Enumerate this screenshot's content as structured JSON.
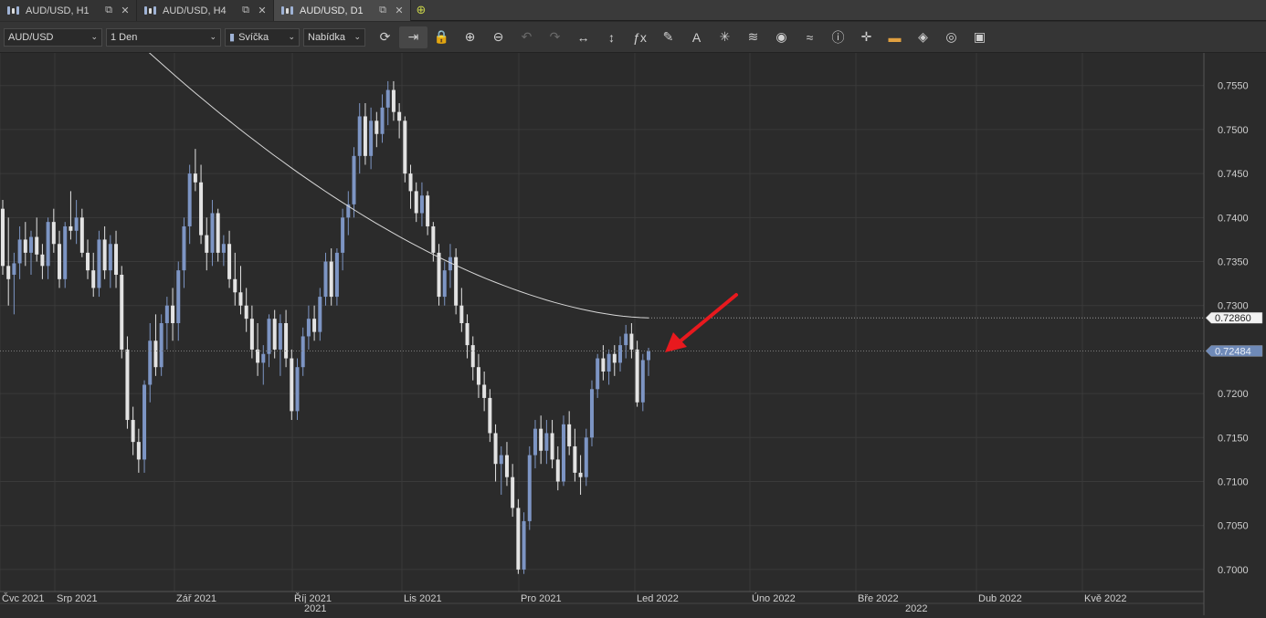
{
  "tabs": [
    {
      "label": "AUD/USD, H1",
      "active": false
    },
    {
      "label": "AUD/USD, H4",
      "active": false
    },
    {
      "label": "AUD/USD, D1",
      "active": true
    }
  ],
  "toolbar": {
    "symbol": "AUD/USD",
    "timeframe": "1 Den",
    "chart_type": "Svíčka",
    "price_type": "Nabídka",
    "icons": [
      "refresh-icon",
      "auto-scroll-icon",
      "lock-icon",
      "zoom-in-icon",
      "zoom-out-icon",
      "undo-icon",
      "redo-icon",
      "horizontal-fit-icon",
      "vertical-fit-icon",
      "indicator-fx-icon",
      "pencil-icon",
      "text-tool-icon",
      "crosshair-star-icon",
      "layers-icon",
      "eye-icon",
      "strategy-icon",
      "info-icon",
      "crosshair-icon",
      "color-bar-icon",
      "paint-bucket-icon",
      "target-icon",
      "save-icon"
    ]
  },
  "chart_data": {
    "type": "candlestick",
    "symbol": "AUD/USD",
    "timeframe": "D1",
    "ylim": [
      0.6975,
      0.7585
    ],
    "y_ticks": [
      "0.7550",
      "0.7500",
      "0.7450",
      "0.7400",
      "0.7350",
      "0.7300",
      "0.7200",
      "0.7150",
      "0.7100",
      "0.7050",
      "0.7000"
    ],
    "x_month_labels": [
      "Čvc 2021",
      "Srp 2021",
      "Zář 2021",
      "Říj 2021",
      "Lis 2021",
      "Pro 2021",
      "Led 2022",
      "Úno 2022",
      "Bře 2022",
      "Dub 2022",
      "Kvě 2022"
    ],
    "x_year_labels": [
      "2021",
      "2022"
    ],
    "ma_label": "0.72860",
    "ma_value": 0.7286,
    "last_price_label": "0.72484",
    "last_price": 0.72484,
    "colors": {
      "bull": "#7d95c4",
      "bear": "#e3e3e3",
      "ma": "#d8d8d8",
      "arrow": "#e8191e",
      "grid": "#3a3a3a",
      "bg": "#2b2b2b"
    },
    "candles": [
      [
        0.741,
        0.742,
        0.7335,
        0.7345
      ],
      [
        0.7345,
        0.74,
        0.73,
        0.733
      ],
      [
        0.7335,
        0.736,
        0.729,
        0.7348
      ],
      [
        0.7348,
        0.739,
        0.733,
        0.7375
      ],
      [
        0.7375,
        0.7395,
        0.7345,
        0.736
      ],
      [
        0.736,
        0.7385,
        0.7335,
        0.7378
      ],
      [
        0.7378,
        0.74,
        0.735,
        0.7358
      ],
      [
        0.7358,
        0.737,
        0.733,
        0.7345
      ],
      [
        0.7345,
        0.74,
        0.733,
        0.7395
      ],
      [
        0.7395,
        0.741,
        0.736,
        0.737
      ],
      [
        0.737,
        0.7385,
        0.732,
        0.733
      ],
      [
        0.733,
        0.7395,
        0.732,
        0.739
      ],
      [
        0.739,
        0.743,
        0.7375,
        0.7385
      ],
      [
        0.7385,
        0.742,
        0.737,
        0.74
      ],
      [
        0.74,
        0.741,
        0.7355,
        0.736
      ],
      [
        0.736,
        0.7375,
        0.733,
        0.734
      ],
      [
        0.734,
        0.736,
        0.731,
        0.732
      ],
      [
        0.732,
        0.7385,
        0.731,
        0.7375
      ],
      [
        0.7375,
        0.739,
        0.733,
        0.734
      ],
      [
        0.734,
        0.738,
        0.732,
        0.737
      ],
      [
        0.737,
        0.7385,
        0.732,
        0.7335
      ],
      [
        0.7335,
        0.7345,
        0.724,
        0.725
      ],
      [
        0.725,
        0.7265,
        0.716,
        0.717
      ],
      [
        0.717,
        0.7185,
        0.713,
        0.7145
      ],
      [
        0.7145,
        0.716,
        0.711,
        0.7125
      ],
      [
        0.7125,
        0.7215,
        0.711,
        0.721
      ],
      [
        0.721,
        0.728,
        0.719,
        0.726
      ],
      [
        0.726,
        0.729,
        0.722,
        0.723
      ],
      [
        0.723,
        0.729,
        0.722,
        0.728
      ],
      [
        0.728,
        0.731,
        0.725,
        0.73
      ],
      [
        0.73,
        0.732,
        0.726,
        0.728
      ],
      [
        0.728,
        0.735,
        0.726,
        0.734
      ],
      [
        0.734,
        0.74,
        0.732,
        0.739
      ],
      [
        0.739,
        0.746,
        0.737,
        0.745
      ],
      [
        0.745,
        0.7478,
        0.743,
        0.744
      ],
      [
        0.744,
        0.746,
        0.737,
        0.738
      ],
      [
        0.738,
        0.74,
        0.734,
        0.736
      ],
      [
        0.736,
        0.742,
        0.7345,
        0.7405
      ],
      [
        0.7405,
        0.741,
        0.735,
        0.736
      ],
      [
        0.736,
        0.738,
        0.7345,
        0.737
      ],
      [
        0.737,
        0.7385,
        0.732,
        0.733
      ],
      [
        0.733,
        0.736,
        0.73,
        0.7315
      ],
      [
        0.7315,
        0.7345,
        0.729,
        0.73
      ],
      [
        0.73,
        0.732,
        0.727,
        0.7285
      ],
      [
        0.7285,
        0.73,
        0.724,
        0.725
      ],
      [
        0.725,
        0.728,
        0.722,
        0.7235
      ],
      [
        0.7235,
        0.7255,
        0.721,
        0.7245
      ],
      [
        0.7245,
        0.729,
        0.723,
        0.7285
      ],
      [
        0.7285,
        0.7295,
        0.724,
        0.725
      ],
      [
        0.725,
        0.729,
        0.722,
        0.728
      ],
      [
        0.728,
        0.7295,
        0.723,
        0.724
      ],
      [
        0.724,
        0.725,
        0.717,
        0.718
      ],
      [
        0.718,
        0.724,
        0.717,
        0.723
      ],
      [
        0.723,
        0.7275,
        0.722,
        0.7265
      ],
      [
        0.7265,
        0.73,
        0.725,
        0.7285
      ],
      [
        0.7285,
        0.73,
        0.726,
        0.727
      ],
      [
        0.727,
        0.732,
        0.726,
        0.731
      ],
      [
        0.731,
        0.736,
        0.73,
        0.735
      ],
      [
        0.735,
        0.7365,
        0.73,
        0.731
      ],
      [
        0.731,
        0.7365,
        0.73,
        0.736
      ],
      [
        0.736,
        0.741,
        0.734,
        0.74
      ],
      [
        0.74,
        0.743,
        0.738,
        0.7415
      ],
      [
        0.7415,
        0.748,
        0.74,
        0.747
      ],
      [
        0.747,
        0.753,
        0.745,
        0.7515
      ],
      [
        0.7515,
        0.753,
        0.746,
        0.747
      ],
      [
        0.747,
        0.7525,
        0.7455,
        0.751
      ],
      [
        0.751,
        0.752,
        0.748,
        0.7495
      ],
      [
        0.7495,
        0.754,
        0.7485,
        0.7525
      ],
      [
        0.7525,
        0.7555,
        0.7505,
        0.7545
      ],
      [
        0.7545,
        0.7555,
        0.751,
        0.752
      ],
      [
        0.752,
        0.753,
        0.749,
        0.751
      ],
      [
        0.751,
        0.7515,
        0.744,
        0.745
      ],
      [
        0.745,
        0.746,
        0.741,
        0.743
      ],
      [
        0.743,
        0.744,
        0.7395,
        0.7405
      ],
      [
        0.7405,
        0.744,
        0.739,
        0.7425
      ],
      [
        0.7425,
        0.743,
        0.738,
        0.739
      ],
      [
        0.739,
        0.7395,
        0.735,
        0.736
      ],
      [
        0.736,
        0.737,
        0.73,
        0.731
      ],
      [
        0.731,
        0.735,
        0.73,
        0.734
      ],
      [
        0.734,
        0.737,
        0.732,
        0.7355
      ],
      [
        0.7355,
        0.7365,
        0.729,
        0.73
      ],
      [
        0.73,
        0.732,
        0.727,
        0.728
      ],
      [
        0.728,
        0.729,
        0.724,
        0.7255
      ],
      [
        0.7255,
        0.7265,
        0.7215,
        0.723
      ],
      [
        0.723,
        0.7245,
        0.7195,
        0.721
      ],
      [
        0.721,
        0.7225,
        0.718,
        0.7195
      ],
      [
        0.7195,
        0.7205,
        0.7145,
        0.7155
      ],
      [
        0.7155,
        0.7165,
        0.71,
        0.712
      ],
      [
        0.712,
        0.714,
        0.7085,
        0.713
      ],
      [
        0.713,
        0.7145,
        0.7095,
        0.7105
      ],
      [
        0.7105,
        0.712,
        0.706,
        0.707
      ],
      [
        0.707,
        0.708,
        0.6995,
        0.7
      ],
      [
        0.7,
        0.7065,
        0.6995,
        0.7055
      ],
      [
        0.7055,
        0.714,
        0.7045,
        0.713
      ],
      [
        0.713,
        0.717,
        0.7115,
        0.716
      ],
      [
        0.716,
        0.7175,
        0.712,
        0.7135
      ],
      [
        0.7135,
        0.717,
        0.712,
        0.7155
      ],
      [
        0.7155,
        0.717,
        0.7115,
        0.7125
      ],
      [
        0.7125,
        0.714,
        0.709,
        0.71
      ],
      [
        0.71,
        0.7175,
        0.7095,
        0.7165
      ],
      [
        0.7165,
        0.718,
        0.713,
        0.714
      ],
      [
        0.714,
        0.716,
        0.71,
        0.711
      ],
      [
        0.711,
        0.713,
        0.7085,
        0.7105
      ],
      [
        0.7105,
        0.716,
        0.7095,
        0.715
      ],
      [
        0.715,
        0.7215,
        0.714,
        0.7205
      ],
      [
        0.7205,
        0.7245,
        0.7195,
        0.724
      ],
      [
        0.724,
        0.7255,
        0.7215,
        0.7225
      ],
      [
        0.7225,
        0.725,
        0.721,
        0.7245
      ],
      [
        0.7245,
        0.7255,
        0.722,
        0.7235
      ],
      [
        0.7235,
        0.7265,
        0.7225,
        0.7255
      ],
      [
        0.7255,
        0.7278,
        0.724,
        0.7268
      ],
      [
        0.7268,
        0.728,
        0.724,
        0.725
      ],
      [
        0.725,
        0.726,
        0.7185,
        0.719
      ],
      [
        0.719,
        0.7245,
        0.718,
        0.7238
      ],
      [
        0.7238,
        0.7252,
        0.722,
        0.7248
      ]
    ]
  },
  "annotation": {
    "arrow_color": "#e8191e"
  }
}
